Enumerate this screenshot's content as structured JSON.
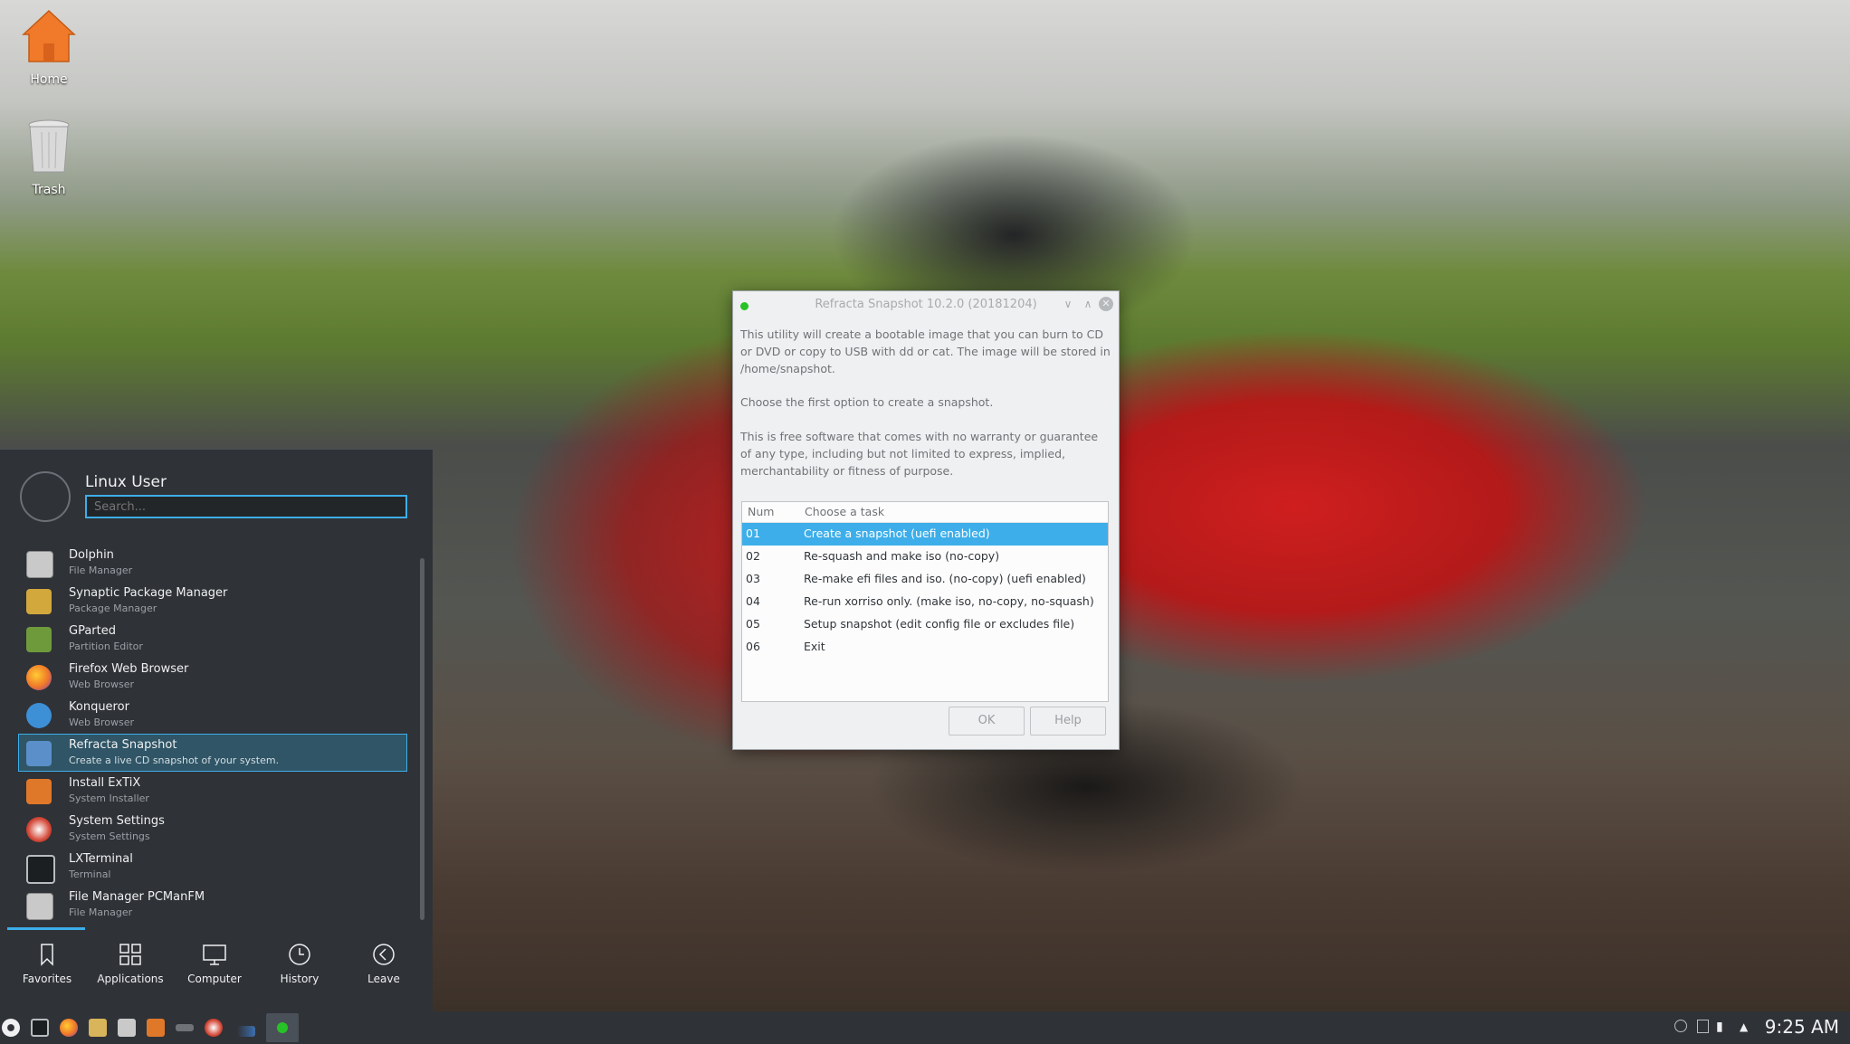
{
  "desktop": {
    "icons": [
      {
        "label": "Home"
      },
      {
        "label": "Trash"
      }
    ]
  },
  "launcher": {
    "username": "Linux User",
    "search_placeholder": "Search...",
    "apps": [
      {
        "name": "Dolphin",
        "desc": "File Manager",
        "icon": "dolphin-icon",
        "color": "#c9c9c9"
      },
      {
        "name": "Synaptic Package Manager",
        "desc": "Package Manager",
        "icon": "synaptic-icon",
        "color": "#d2a83c"
      },
      {
        "name": "GParted",
        "desc": "Partition Editor",
        "icon": "gparted-icon",
        "color": "#6f9a3c"
      },
      {
        "name": "Firefox Web Browser",
        "desc": "Web Browser",
        "icon": "firefox-icon",
        "color": "#e8672a"
      },
      {
        "name": "Konqueror",
        "desc": "Web Browser",
        "icon": "konqueror-icon",
        "color": "#3d8fd6"
      },
      {
        "name": "Refracta Snapshot",
        "desc": "Create a live CD snapshot of your system.",
        "icon": "refracta-icon",
        "color": "#5a8fc9"
      },
      {
        "name": "Install ExTiX",
        "desc": "System Installer",
        "icon": "installer-icon",
        "color": "#e0782a"
      },
      {
        "name": "System Settings",
        "desc": "System Settings",
        "icon": "settings-icon",
        "color": "#c0392b"
      },
      {
        "name": "LXTerminal",
        "desc": "Terminal",
        "icon": "terminal-icon",
        "color": "#3a3f44"
      },
      {
        "name": "File Manager PCManFM",
        "desc": "File Manager",
        "icon": "pcmanfm-icon",
        "color": "#c9c9c9"
      }
    ],
    "tabs": [
      {
        "label": "Favorites",
        "icon": "bookmark-icon"
      },
      {
        "label": "Applications",
        "icon": "grid-icon"
      },
      {
        "label": "Computer",
        "icon": "monitor-icon"
      },
      {
        "label": "History",
        "icon": "clock-icon"
      },
      {
        "label": "Leave",
        "icon": "back-arrow-icon"
      }
    ]
  },
  "dialog": {
    "title": "Refracta Snapshot 10.2.0 (20181204)",
    "intro": "This utility will create a bootable image that you can burn to CD or DVD or copy to USB with dd or cat. The image will be stored in /home/snapshot.",
    "choose": "Choose the first option to create a snapshot.",
    "license": "This is free software that comes with no warranty or guarantee of any type, including but not limited to express, implied, merchantability or fitness of purpose.",
    "columns": {
      "num": "Num",
      "task": "Choose a task"
    },
    "rows": [
      {
        "num": "01",
        "task": "Create a snapshot (uefi enabled)"
      },
      {
        "num": "02",
        "task": "Re-squash and make iso (no-copy)"
      },
      {
        "num": "03",
        "task": "Re-make efi files and iso. (no-copy) (uefi enabled)"
      },
      {
        "num": "04",
        "task": "Re-run xorriso only. (make iso, no-copy, no-squash)"
      },
      {
        "num": "05",
        "task": "Setup snapshot (edit config file or excludes file)"
      },
      {
        "num": "06",
        "task": "Exit"
      }
    ],
    "ok_label": "OK",
    "help_label": "Help"
  },
  "taskbar": {
    "clock": "9:25 AM",
    "accent": "#3daee9"
  }
}
